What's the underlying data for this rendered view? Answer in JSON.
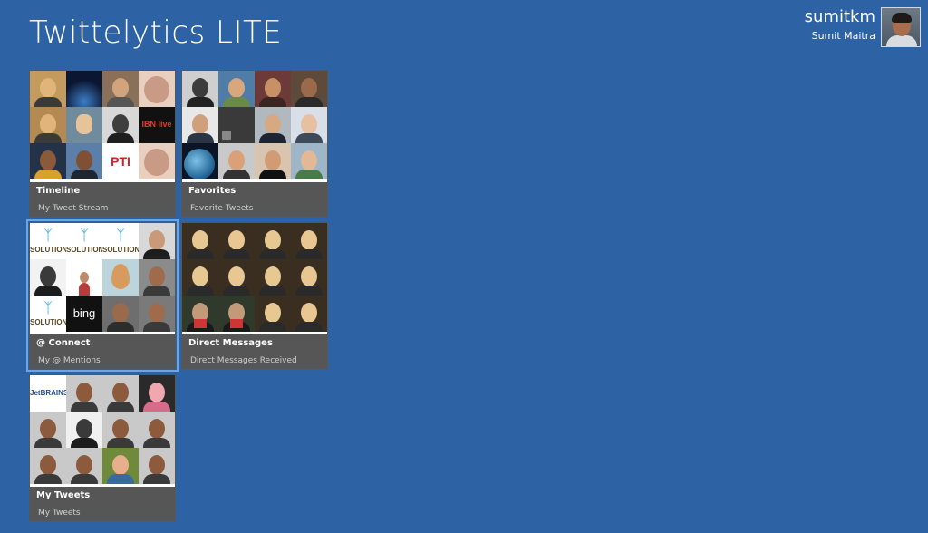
{
  "app": {
    "title": "Twittelytics LITE"
  },
  "user": {
    "handle": "sumitkm",
    "name": "Sumit Maitra"
  },
  "colors": {
    "background": "#2d62a5",
    "tile_footer": "#565656",
    "selected_outline": "#6aa6e6"
  },
  "tiles": [
    {
      "label": "Timeline",
      "subtitle": "My Tweet Stream"
    },
    {
      "label": "Favorites",
      "subtitle": "Favorite Tweets"
    },
    {
      "label": "@ Connect",
      "subtitle": "My @ Mentions"
    },
    {
      "label": "Direct Messages",
      "subtitle": "Direct Messages Received"
    },
    {
      "label": "My Tweets",
      "subtitle": "My Tweets"
    }
  ],
  "logos": {
    "ibn": "IBN live",
    "pti": "PTI",
    "bing": "bing",
    "jetbrains": "JetBRAINS",
    "solution": "SOLUTION"
  }
}
